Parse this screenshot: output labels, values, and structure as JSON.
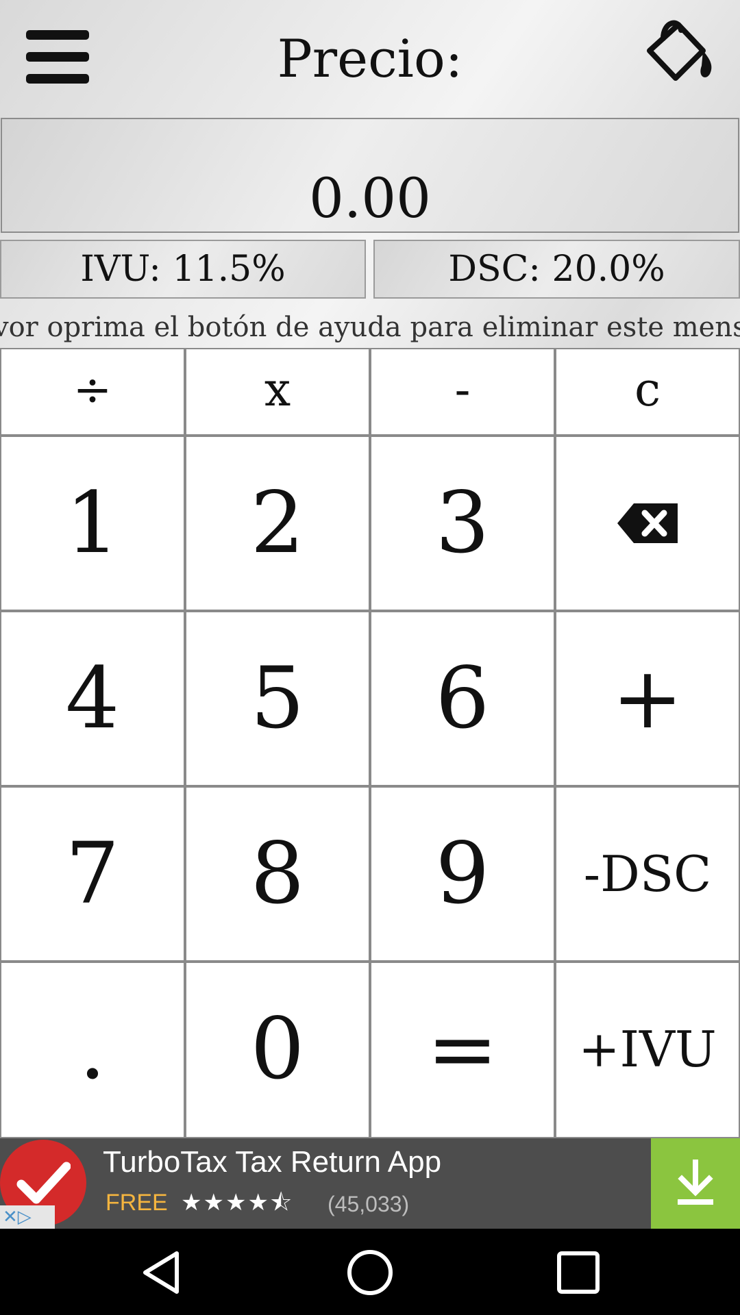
{
  "header": {
    "title": "Precio:",
    "menu_icon": "hamburger-menu-icon",
    "theme_icon": "paint-bucket-icon"
  },
  "display": {
    "value": "0.00"
  },
  "rates": {
    "ivu_label": "IVU: 11.5%",
    "dsc_label": "DSC: 20.0%"
  },
  "marquee": {
    "text": "vor oprima el botón de ayuda para eliminar este mensa"
  },
  "keypad": {
    "divide": "÷",
    "multiply": "x",
    "minus": "-",
    "clear": "c",
    "one": "1",
    "two": "2",
    "three": "3",
    "backspace_icon": "backspace-icon",
    "four": "4",
    "five": "5",
    "six": "6",
    "plus": "+",
    "seven": "7",
    "eight": "8",
    "nine": "9",
    "minus_dsc": "-DSC",
    "dot": ".",
    "zero": "0",
    "equals": "=",
    "plus_ivu": "+IVU"
  },
  "ad": {
    "title": "TurboTax Tax Return App",
    "price": "FREE",
    "rating_stars": "★★★★⯪",
    "rating_value": 4.5,
    "rating_count": "(45,033)",
    "accent_color": "#8bc53f",
    "badge_color": "#d42a2a"
  },
  "navbar": {
    "back_icon": "back-icon",
    "home_icon": "home-icon",
    "recents_icon": "recents-icon"
  }
}
